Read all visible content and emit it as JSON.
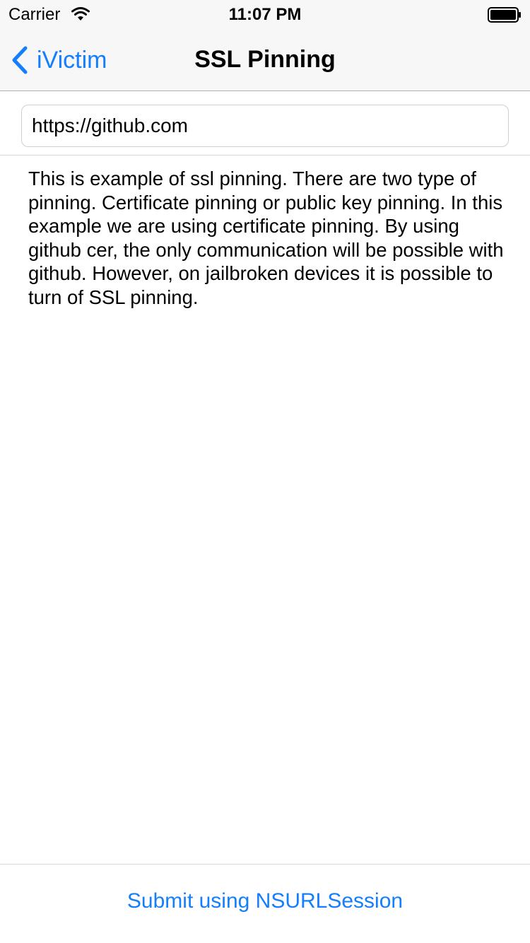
{
  "status_bar": {
    "carrier": "Carrier",
    "time": "11:07 PM",
    "wifi_icon": "wifi-icon",
    "battery_icon": "battery-icon"
  },
  "nav": {
    "back_label": "iVictim",
    "back_icon": "chevron-left-icon",
    "title": "SSL Pinning"
  },
  "form": {
    "url_value": "https://github.com"
  },
  "description": "This is example of ssl pinning. There are two type of pinning. Certificate pinning or public key pinning. In this example we are using certificate pinning. By using github cer, the only communication will be possible with github. However, on jailbroken devices it is possible to turn of SSL pinning.",
  "actions": {
    "submit_label": "Submit using NSURLSession"
  },
  "colors": {
    "accent": "#157efb",
    "bar_background": "#f7f7f7"
  }
}
